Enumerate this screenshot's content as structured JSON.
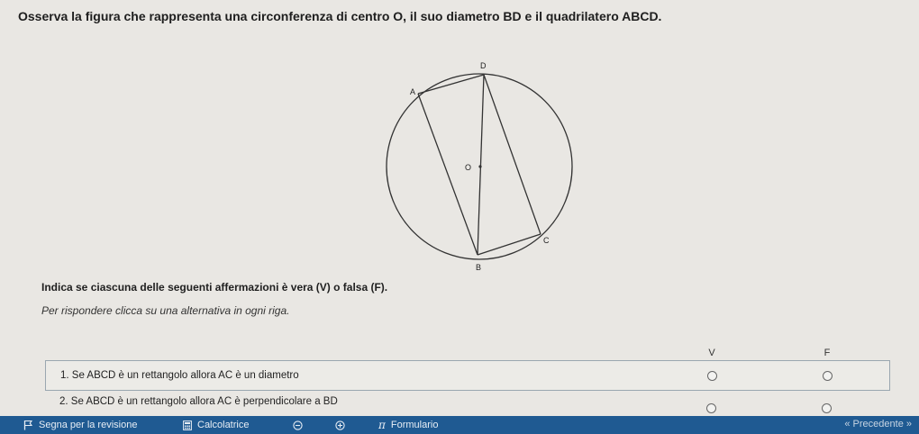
{
  "question": {
    "title": "Osserva la figura che rappresenta una circonferenza di centro O, il suo diametro BD e il quadrilatero ABCD."
  },
  "figure": {
    "points": {
      "D": "D",
      "A": "A",
      "O": "O",
      "C": "C",
      "B": "B"
    }
  },
  "instructions": {
    "main": "Indica se ciascuna delle seguenti affermazioni è vera (V) o falsa (F).",
    "sub": "Per rispondere clicca su una alternativa in ogni riga."
  },
  "table": {
    "columns": [
      "V",
      "F"
    ],
    "rows": [
      {
        "text": "1. Se ABCD è un rettangolo allora AC è un diametro"
      },
      {
        "text": "2. Se ABCD è un rettangolo allora AC è perpendicolare a BD"
      }
    ]
  },
  "toolbar": {
    "review": "Segna per la revisione",
    "calculator": "Calcolatrice",
    "formulary": "Formulario",
    "prev_hint": "Precedente"
  },
  "colors": {
    "toolbar_bg": "#1f5a92",
    "page_bg": "#e9e7e3"
  }
}
